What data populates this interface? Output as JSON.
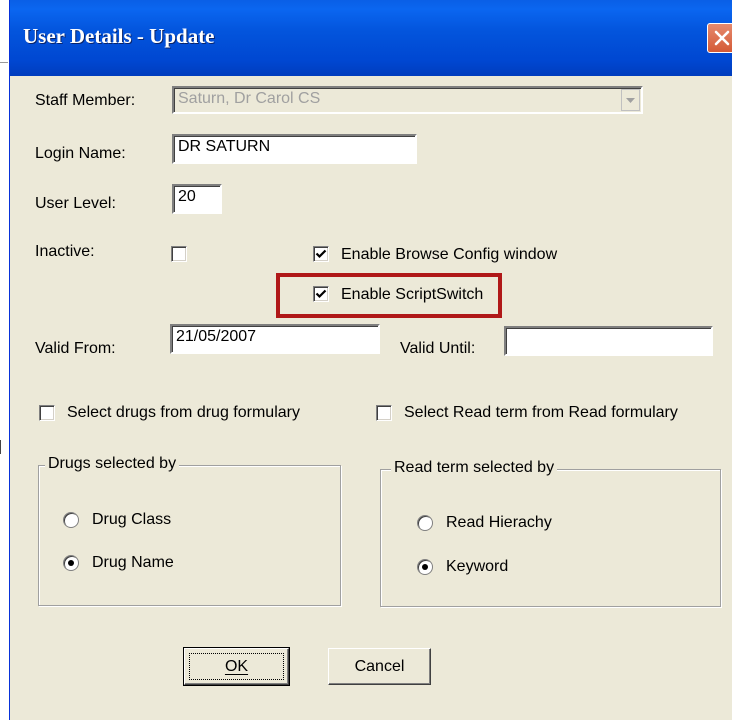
{
  "window": {
    "title": "User Details - Update"
  },
  "form": {
    "staff_member_label": "Staff Member:",
    "staff_member_value": "Saturn, Dr Carol CS",
    "login_name_label": "Login Name:",
    "login_name_value": "DR SATURN",
    "user_level_label": "User Level:",
    "user_level_value": "20",
    "inactive_label": "Inactive:",
    "inactive_checked": false,
    "browse_config_label": "Enable Browse Config window",
    "browse_config_checked": true,
    "scriptswitch_label": "Enable ScriptSwitch",
    "scriptswitch_checked": true,
    "valid_from_label": "Valid From:",
    "valid_from_value": "21/05/2007",
    "valid_until_label": "Valid Until:",
    "valid_until_value": "",
    "drug_formulary_label": "Select drugs from drug formulary",
    "drug_formulary_checked": false,
    "read_formulary_label": "Select Read term from Read formulary",
    "read_formulary_checked": false
  },
  "drugs_group": {
    "title": "Drugs selected by",
    "options": [
      "Drug Class",
      "Drug Name"
    ],
    "selected": "Drug Name"
  },
  "read_group": {
    "title": "Read term selected by",
    "options": [
      "Read Hierachy",
      "Keyword"
    ],
    "selected": "Keyword"
  },
  "buttons": {
    "ok_label": "OK",
    "cancel_label": "Cancel"
  },
  "colors": {
    "titlebar": "#0047d1",
    "dialog_bg": "#ece9d8",
    "highlight": "#b01818",
    "close_button": "#d45a36"
  }
}
